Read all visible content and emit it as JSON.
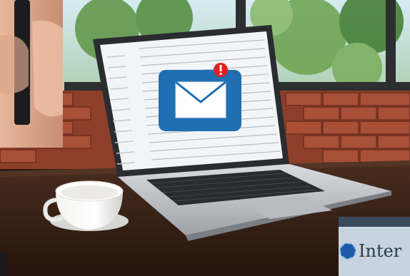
{
  "scene": {
    "description_icons": [
      "mail-envelope-icon",
      "alert-badge-icon",
      "coffee-cup",
      "laptop"
    ],
    "alert_symbol": "!",
    "inset_text": "Inter"
  },
  "colors": {
    "envelope_blue": "#1f6fb2",
    "alert_red": "#e02020",
    "brick": "#9a4a32",
    "table_wood": "#3b2418",
    "laptop_silver": "#c9ccd1",
    "sky_window": "#bfe0ec",
    "foliage": "#3f7a2e"
  }
}
